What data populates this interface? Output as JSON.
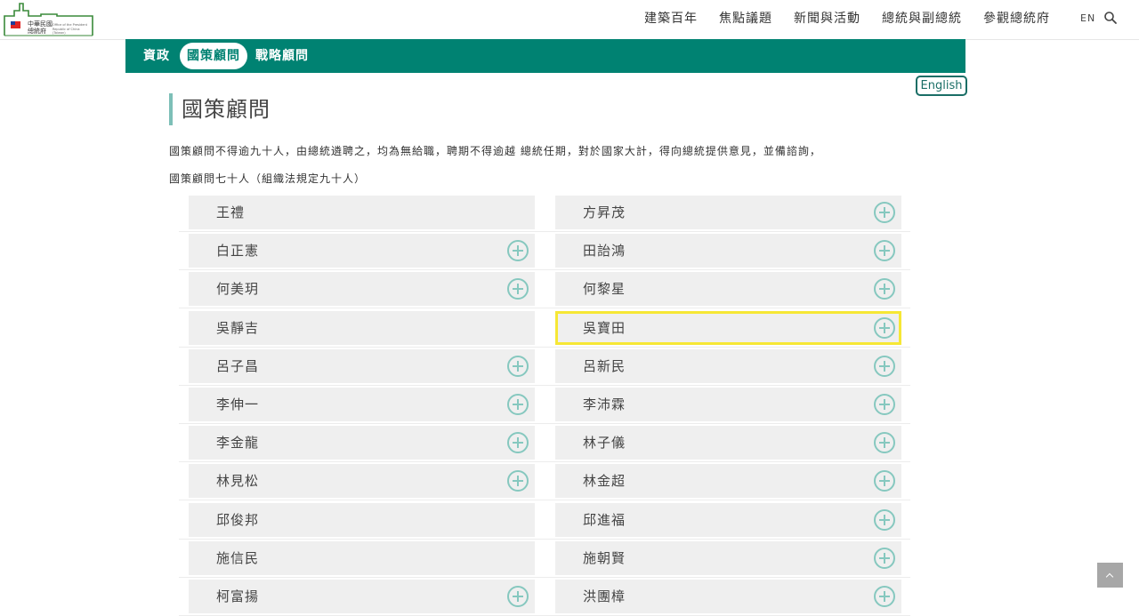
{
  "header": {
    "logo": {
      "line1": "中華民國",
      "line2": "總統府",
      "en_line": "Office of the President Republic of China (Taiwan)"
    },
    "nav": [
      "建築百年",
      "焦點議題",
      "新聞與活動",
      "總統與副總統",
      "參觀總統府"
    ],
    "lang": "EN",
    "icons": {
      "search": "search-icon"
    }
  },
  "subnav": {
    "tabs": [
      {
        "label": "資政",
        "active": false
      },
      {
        "label": "國策顧問",
        "active": true
      },
      {
        "label": "戰略顧問",
        "active": false
      }
    ]
  },
  "english_button": "English",
  "page": {
    "title": "國策顧問",
    "desc1": "國策顧問不得逾九十人，由總統遴聘之，均為無給職，聘期不得逾越 總統任期，對於國家大計，得向總統提供意見，並備諮詢，",
    "desc2": "國策顧問七十人（組織法規定九十人）"
  },
  "advisors": [
    {
      "name": "王禮",
      "expandable": false
    },
    {
      "name": "方昇茂",
      "expandable": true
    },
    {
      "name": "白正憲",
      "expandable": true
    },
    {
      "name": "田詒鴻",
      "expandable": true
    },
    {
      "name": "何美玥",
      "expandable": true
    },
    {
      "name": "何黎星",
      "expandable": true
    },
    {
      "name": "吳靜吉",
      "expandable": false
    },
    {
      "name": "吳寶田",
      "expandable": true,
      "selected": true
    },
    {
      "name": "呂子昌",
      "expandable": true
    },
    {
      "name": "呂新民",
      "expandable": true
    },
    {
      "name": "李伸一",
      "expandable": true
    },
    {
      "name": "李沛霖",
      "expandable": true
    },
    {
      "name": "李金龍",
      "expandable": true
    },
    {
      "name": "林子儀",
      "expandable": true
    },
    {
      "name": "林見松",
      "expandable": true
    },
    {
      "name": "林金超",
      "expandable": true
    },
    {
      "name": "邱俊邦",
      "expandable": false
    },
    {
      "name": "邱進福",
      "expandable": true
    },
    {
      "name": "施信民",
      "expandable": false
    },
    {
      "name": "施朝賢",
      "expandable": true
    },
    {
      "name": "柯富揚",
      "expandable": true
    },
    {
      "name": "洪團樟",
      "expandable": true
    }
  ],
  "colors": {
    "brand": "#008272",
    "plus": "#86c8bf",
    "highlight": "#f6e735",
    "cell_bg": "#efefef"
  }
}
